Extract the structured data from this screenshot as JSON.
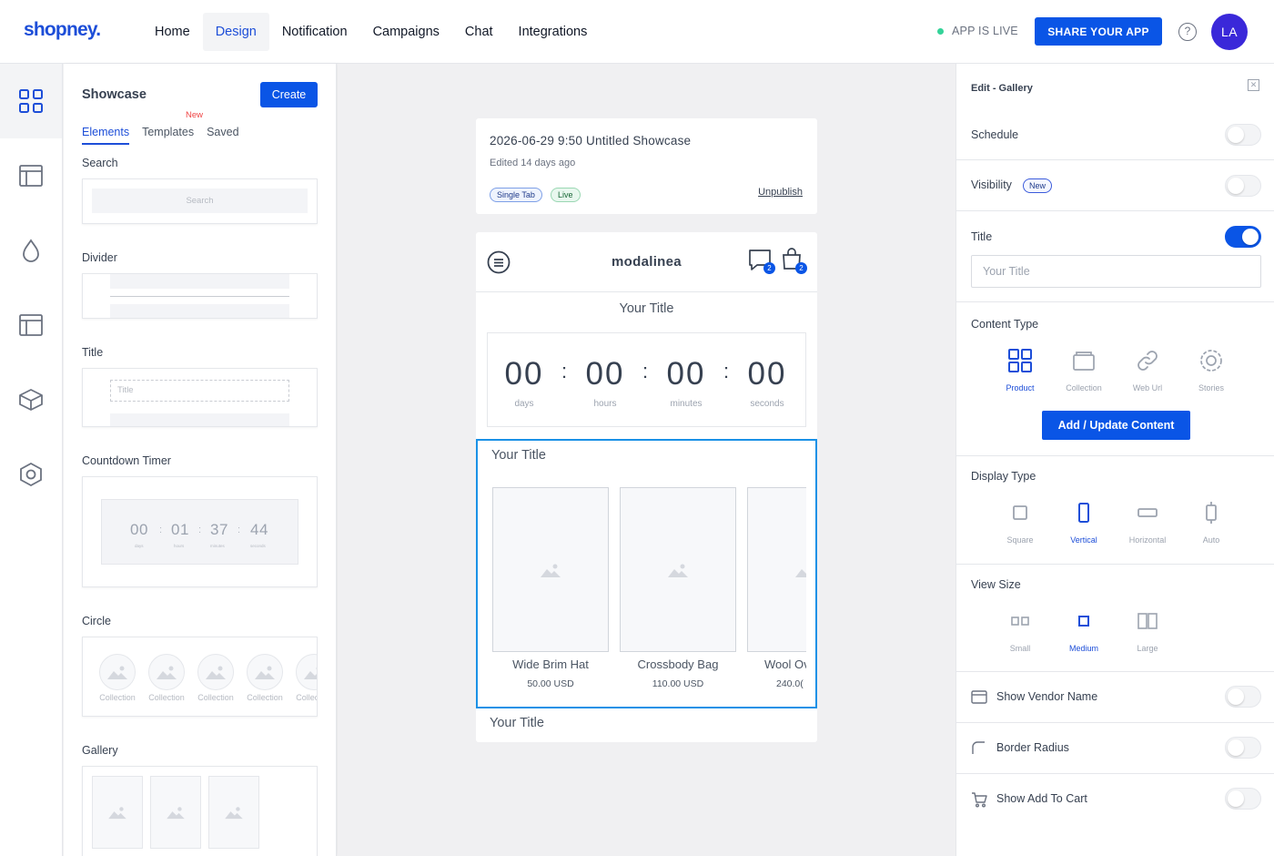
{
  "header": {
    "logo": "shopney.",
    "nav": [
      "Home",
      "Design",
      "Notification",
      "Campaigns",
      "Chat",
      "Integrations"
    ],
    "active_nav": "Design",
    "status": "APP IS LIVE",
    "share_label": "SHARE YOUR APP",
    "help_icon": "?",
    "avatar": "LA"
  },
  "rail": {
    "icons": [
      "grid-icon",
      "layout-icon",
      "droplet-icon",
      "template-icon",
      "box-icon",
      "settings-hex-icon"
    ]
  },
  "showcase_panel": {
    "title": "Showcase",
    "create_label": "Create",
    "new_tag": "New",
    "tabs": [
      "Elements",
      "Templates",
      "Saved"
    ],
    "sections": {
      "search": {
        "label": "Search",
        "placeholder": "Search"
      },
      "divider": {
        "label": "Divider"
      },
      "title": {
        "label": "Title",
        "placeholder": "Title"
      },
      "countdown": {
        "label": "Countdown Timer",
        "values": [
          "00",
          "01",
          "37",
          "44"
        ],
        "units": [
          "days",
          "hours",
          "minutes",
          "seconds"
        ]
      },
      "circle": {
        "label": "Circle",
        "item_label": "Collection",
        "items": [
          "Collection",
          "Collection",
          "Collection",
          "Collection",
          "Collection"
        ]
      },
      "gallery": {
        "label": "Gallery"
      }
    }
  },
  "canvas": {
    "showcase": {
      "title": "2026-06-29 9:50 Untitled Showcase",
      "edited": "Edited 14 days ago",
      "tags": [
        "Single Tab",
        "Live"
      ],
      "unpublish_label": "Unpublish"
    },
    "phone": {
      "store_name": "modalinea",
      "chat_badge": "2",
      "cart_badge": "2",
      "title_block": "Your Title",
      "countdown": {
        "values": [
          "00",
          "00",
          "00",
          "00"
        ],
        "units": [
          "days",
          "hours",
          "minutes",
          "seconds"
        ]
      },
      "gallery": {
        "title": "Your Title",
        "products": [
          {
            "name": "Wide Brim Hat",
            "price": "50.00 USD"
          },
          {
            "name": "Crossbody Bag",
            "price": "110.00 USD"
          },
          {
            "name": "Wool Ov",
            "price": "240.0("
          }
        ]
      },
      "bottom_title": "Your Title"
    }
  },
  "edit_panel": {
    "heading": "Edit - Gallery",
    "schedule": {
      "label": "Schedule",
      "on": false
    },
    "visibility": {
      "label": "Visibility",
      "badge": "New",
      "on": false
    },
    "title": {
      "label": "Title",
      "on": true,
      "placeholder": "Your Title"
    },
    "content_type": {
      "label": "Content Type",
      "options": [
        "Product",
        "Collection",
        "Web Url",
        "Stories"
      ],
      "selected": "Product",
      "button": "Add / Update Content"
    },
    "display_type": {
      "label": "Display Type",
      "options": [
        "Square",
        "Vertical",
        "Horizontal",
        "Auto"
      ],
      "selected": "Vertical"
    },
    "view_size": {
      "label": "View Size",
      "options": [
        "Small",
        "Medium",
        "Large"
      ],
      "selected": "Medium"
    },
    "vendor": {
      "label": "Show Vendor Name",
      "on": false
    },
    "radius": {
      "label": "Border Radius",
      "on": false
    },
    "cart": {
      "label": "Show Add To Cart",
      "on": false
    }
  },
  "colors": {
    "primary": "#0a55e6",
    "accent_selection": "#1a91e6",
    "avatar": "#3a28d9",
    "live_dot": "#34d399",
    "new_red": "#ef4444"
  }
}
